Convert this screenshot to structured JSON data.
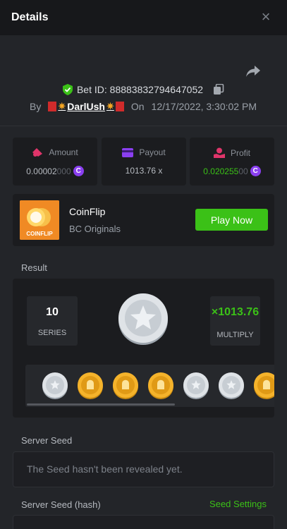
{
  "header": {
    "title": "Details",
    "close_label": "×"
  },
  "bet": {
    "id_label": "Bet ID: 88883832794647052",
    "by_label": "By",
    "user": "DarlUsh",
    "on_label": "On",
    "datetime": "12/17/2022, 3:30:02 PM"
  },
  "stats": {
    "amount": {
      "label": "Amount",
      "value_main": "0.00002",
      "value_dim": "000"
    },
    "payout": {
      "label": "Payout",
      "value": "1013.76 x"
    },
    "profit": {
      "label": "Profit",
      "value_main": "0.020255",
      "value_dim": "00"
    }
  },
  "game": {
    "name": "CoinFlip",
    "provider": "BC Originals",
    "play_label": "Play Now",
    "thumb_text": "COINFLIP"
  },
  "result": {
    "section_label": "Result",
    "series_value": "10",
    "series_label": "SERIES",
    "multiply_value": "×1013.76",
    "multiply_label": "MULTIPLY",
    "coins": [
      "silver",
      "gold",
      "gold",
      "gold",
      "silver",
      "silver",
      "gold"
    ]
  },
  "seed": {
    "server_seed_label": "Server Seed",
    "server_seed_text": "The Seed hasn't been revealed yet.",
    "hash_label": "Server Seed (hash)",
    "settings_label": "Seed Settings"
  },
  "colors": {
    "accent_green": "#3bc117",
    "currency_purple": "#8a3ff0",
    "panel": "#232529"
  },
  "icons": [
    "close-icon",
    "share-icon",
    "shield-check-icon",
    "copy-icon",
    "amount-icon",
    "payout-icon",
    "profit-icon",
    "currency-c-icon",
    "star-coin-icon"
  ]
}
